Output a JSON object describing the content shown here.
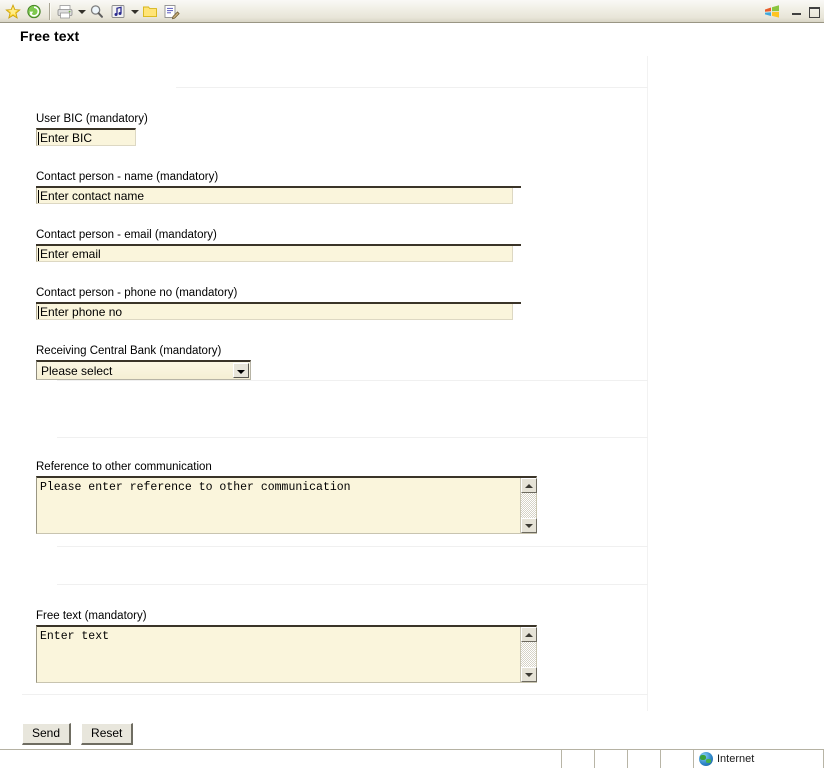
{
  "browser": {
    "toolbar": {
      "icons": [
        {
          "name": "favorites-star-icon",
          "glyph": "star"
        },
        {
          "name": "history-icon",
          "glyph": "history"
        },
        {
          "name": "print-icon",
          "glyph": "print"
        },
        {
          "name": "print-dropdown-arrow-icon",
          "glyph": "caret-down"
        },
        {
          "name": "search-icon",
          "glyph": "search"
        },
        {
          "name": "media-icon",
          "glyph": "media"
        },
        {
          "name": "media-dropdown-arrow-icon",
          "glyph": "caret-down"
        },
        {
          "name": "folder-icon",
          "glyph": "folder"
        },
        {
          "name": "edit-icon",
          "glyph": "edit"
        }
      ]
    },
    "window_controls": {
      "minimize_label": "Minimize",
      "restore_label": "Restore"
    },
    "statusbar": {
      "zone_label": "Internet",
      "zone_icon": "internet-zone-globe-icon"
    }
  },
  "page": {
    "title": "Free text"
  },
  "form": {
    "fields": [
      {
        "id": "user-bic",
        "label": "User BIC (mandatory)",
        "value": "Enter BIC",
        "placeholder": "Enter BIC",
        "type": "text"
      },
      {
        "id": "contact-name",
        "label": "Contact person - name (mandatory)",
        "value": "Enter contact name",
        "placeholder": "Enter contact name",
        "type": "text"
      },
      {
        "id": "contact-email",
        "label": "Contact person - email (mandatory)",
        "value": "Enter email",
        "placeholder": "Enter email",
        "type": "text"
      },
      {
        "id": "contact-phone",
        "label": "Contact person - phone no (mandatory)",
        "value": "Enter phone no",
        "placeholder": "Enter phone no",
        "type": "text"
      },
      {
        "id": "receiving-central-bank",
        "label": "Receiving Central Bank (mandatory)",
        "value": "Please select",
        "type": "select"
      },
      {
        "id": "reference-other-communication",
        "label": "Reference to other communication",
        "value": "Please enter reference to other communication",
        "type": "textarea"
      },
      {
        "id": "free-text",
        "label": "Free text (mandatory)",
        "value": "Enter text",
        "type": "textarea"
      }
    ],
    "buttons": {
      "send_label": "Send",
      "reset_label": "Reset"
    }
  },
  "colors": {
    "input_background": "#faf5dc",
    "input_top_border": "#3a3428",
    "page_background": "#ffffff",
    "toolbar_background": "#f0eee4",
    "statusbar_background": "#eceades"
  }
}
